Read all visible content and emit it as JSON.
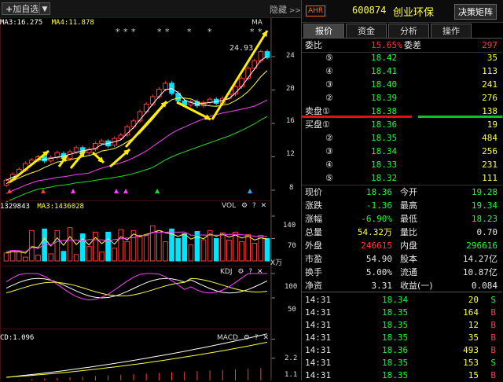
{
  "toolbar": {
    "add_fav": "加自选",
    "hide_label": "隐藏"
  },
  "kline": {
    "ma_labels": [
      "MA3:16.275",
      "MA4:11.878"
    ],
    "ma_tag": "MA",
    "high_label": "24.93",
    "y_ticks": [
      "24",
      "20",
      "16",
      "12",
      "8"
    ],
    "candles": [
      {
        "o": 8.6,
        "c": 9.2
      },
      {
        "o": 9.2,
        "c": 9.9
      },
      {
        "o": 9.9,
        "c": 10.5
      },
      {
        "o": 10.4,
        "c": 11.2
      },
      {
        "o": 11.2,
        "c": 11.6
      },
      {
        "o": 11.6,
        "c": 12.0
      },
      {
        "o": 12.0,
        "c": 11.5
      },
      {
        "o": 11.5,
        "c": 11.9
      },
      {
        "o": 11.9,
        "c": 12.5
      },
      {
        "o": 12.4,
        "c": 11.8
      },
      {
        "o": 11.8,
        "c": 12.6
      },
      {
        "o": 12.6,
        "c": 13.1
      },
      {
        "o": 13.1,
        "c": 12.5
      },
      {
        "o": 12.5,
        "c": 12.9
      },
      {
        "o": 12.9,
        "c": 13.6
      },
      {
        "o": 13.6,
        "c": 13.9
      },
      {
        "o": 13.9,
        "c": 13.3
      },
      {
        "o": 13.4,
        "c": 14.2
      },
      {
        "o": 14.2,
        "c": 14.6
      },
      {
        "o": 14.6,
        "c": 15.6
      },
      {
        "o": 15.6,
        "c": 16.3
      },
      {
        "o": 16.3,
        "c": 17.4
      },
      {
        "o": 17.4,
        "c": 18.3
      },
      {
        "o": 18.3,
        "c": 19.2
      },
      {
        "o": 19.2,
        "c": 20.1
      },
      {
        "o": 20.1,
        "c": 20.8
      },
      {
        "o": 20.8,
        "c": 19.6
      },
      {
        "o": 19.6,
        "c": 18.7
      },
      {
        "o": 18.7,
        "c": 18.2
      },
      {
        "o": 18.2,
        "c": 18.6
      },
      {
        "o": 18.6,
        "c": 18.1
      },
      {
        "o": 18.1,
        "c": 18.5
      },
      {
        "o": 18.5,
        "c": 18.9
      },
      {
        "o": 18.9,
        "c": 18.4
      },
      {
        "o": 18.4,
        "c": 19.0
      },
      {
        "o": 19.0,
        "c": 19.5
      },
      {
        "o": 19.5,
        "c": 20.4
      },
      {
        "o": 20.4,
        "c": 21.4
      },
      {
        "o": 21.4,
        "c": 22.6
      },
      {
        "o": 22.6,
        "c": 23.5
      },
      {
        "o": 23.5,
        "c": 24.6
      },
      {
        "o": 24.6,
        "c": 23.9
      }
    ]
  },
  "volume": {
    "labels": [
      "1329843",
      "MA3:1436028"
    ],
    "title": "VOL",
    "y_ticks": [
      "140",
      "70"
    ],
    "unit": "X万",
    "bars": [
      25,
      33,
      28,
      12,
      95,
      18,
      100,
      22,
      95,
      30,
      104,
      20,
      85,
      45,
      90,
      28,
      90,
      40,
      98,
      60,
      95,
      75,
      80,
      110,
      95,
      60,
      100,
      70,
      85,
      50,
      92,
      66,
      95,
      70,
      88,
      65,
      90,
      60,
      82,
      55,
      80,
      70
    ]
  },
  "kdj": {
    "title": "KDJ",
    "y_ticks": [
      "100",
      "50"
    ]
  },
  "macd": {
    "label": "CD:1.096",
    "title": "MACD",
    "y_ticks": [
      "2.2",
      "1.1"
    ]
  },
  "quote_header": {
    "exchange_tag": "AHR",
    "code": "600874",
    "name": "创业环保",
    "decision_btn": "决策矩阵"
  },
  "tabs": [
    "报价",
    "资金",
    "分析",
    "操作"
  ],
  "order_book": {
    "ratio_label": "委比",
    "ratio": "15.65%",
    "diff_label": "委差",
    "diff": "297",
    "asks": [
      {
        "level": "⑤",
        "price": "18.42",
        "vol": "35"
      },
      {
        "level": "④",
        "price": "18.41",
        "vol": "113"
      },
      {
        "level": "③",
        "price": "18.40",
        "vol": "241"
      },
      {
        "level": "②",
        "price": "18.39",
        "vol": "276"
      },
      {
        "level": "卖盘①",
        "price": "18.38",
        "vol": "138"
      }
    ],
    "bids": [
      {
        "level": "买盘①",
        "price": "18.36",
        "vol": "19"
      },
      {
        "level": "②",
        "price": "18.35",
        "vol": "484"
      },
      {
        "level": "③",
        "price": "18.34",
        "vol": "256"
      },
      {
        "level": "④",
        "price": "18.33",
        "vol": "231"
      },
      {
        "level": "⑤",
        "price": "18.32",
        "vol": "111"
      }
    ]
  },
  "stats": [
    {
      "l1": "现价",
      "v1": "18.36",
      "l2": "今开",
      "v2": "19.28",
      "c1": "green",
      "c2": "green"
    },
    {
      "l1": "涨跌",
      "v1": "-1.36",
      "l2": "最高",
      "v2": "19.34",
      "c1": "green",
      "c2": "green"
    },
    {
      "l1": "涨幅",
      "v1": "-6.90%",
      "l2": "最低",
      "v2": "18.23",
      "c1": "green",
      "c2": "green"
    },
    {
      "l1": "总量",
      "v1": "54.32万",
      "l2": "量比",
      "v2": "0.70",
      "c1": "yellow",
      "c2": "white"
    },
    {
      "l1": "外盘",
      "v1": "246615",
      "l2": "内盘",
      "v2": "296616",
      "c1": "red",
      "c2": "green"
    },
    {
      "l1": "市盈",
      "v1": "54.90",
      "l2": "股本",
      "v2": "14.27亿",
      "c1": "white",
      "c2": "white"
    },
    {
      "l1": "换手",
      "v1": "5.00%",
      "l2": "流通",
      "v2": "10.87亿",
      "c1": "white",
      "c2": "white"
    },
    {
      "l1": "净资",
      "v1": "3.31",
      "l2": "收益(一)",
      "v2": "0.084",
      "c1": "white",
      "c2": "white"
    }
  ],
  "ticks": [
    {
      "time": "14:31",
      "price": "18.34",
      "vol": "20",
      "side": "S"
    },
    {
      "time": "14:31",
      "price": "18.35",
      "vol": "164",
      "side": "B"
    },
    {
      "time": "14:31",
      "price": "18.35",
      "vol": "12",
      "side": "B"
    },
    {
      "time": "14:31",
      "price": "18.35",
      "vol": "35",
      "side": "B"
    },
    {
      "time": "14:31",
      "price": "18.36",
      "vol": "493",
      "side": "B"
    },
    {
      "time": "14:31",
      "price": "18.35",
      "vol": "153",
      "side": "S"
    },
    {
      "time": "14:31",
      "price": "18.35",
      "vol": "15",
      "side": "B"
    }
  ],
  "colors": {
    "up": "#ff3b3b",
    "down": "#16ff36",
    "flat_up": "#00e5ff",
    "accent": "#ffff3c"
  }
}
